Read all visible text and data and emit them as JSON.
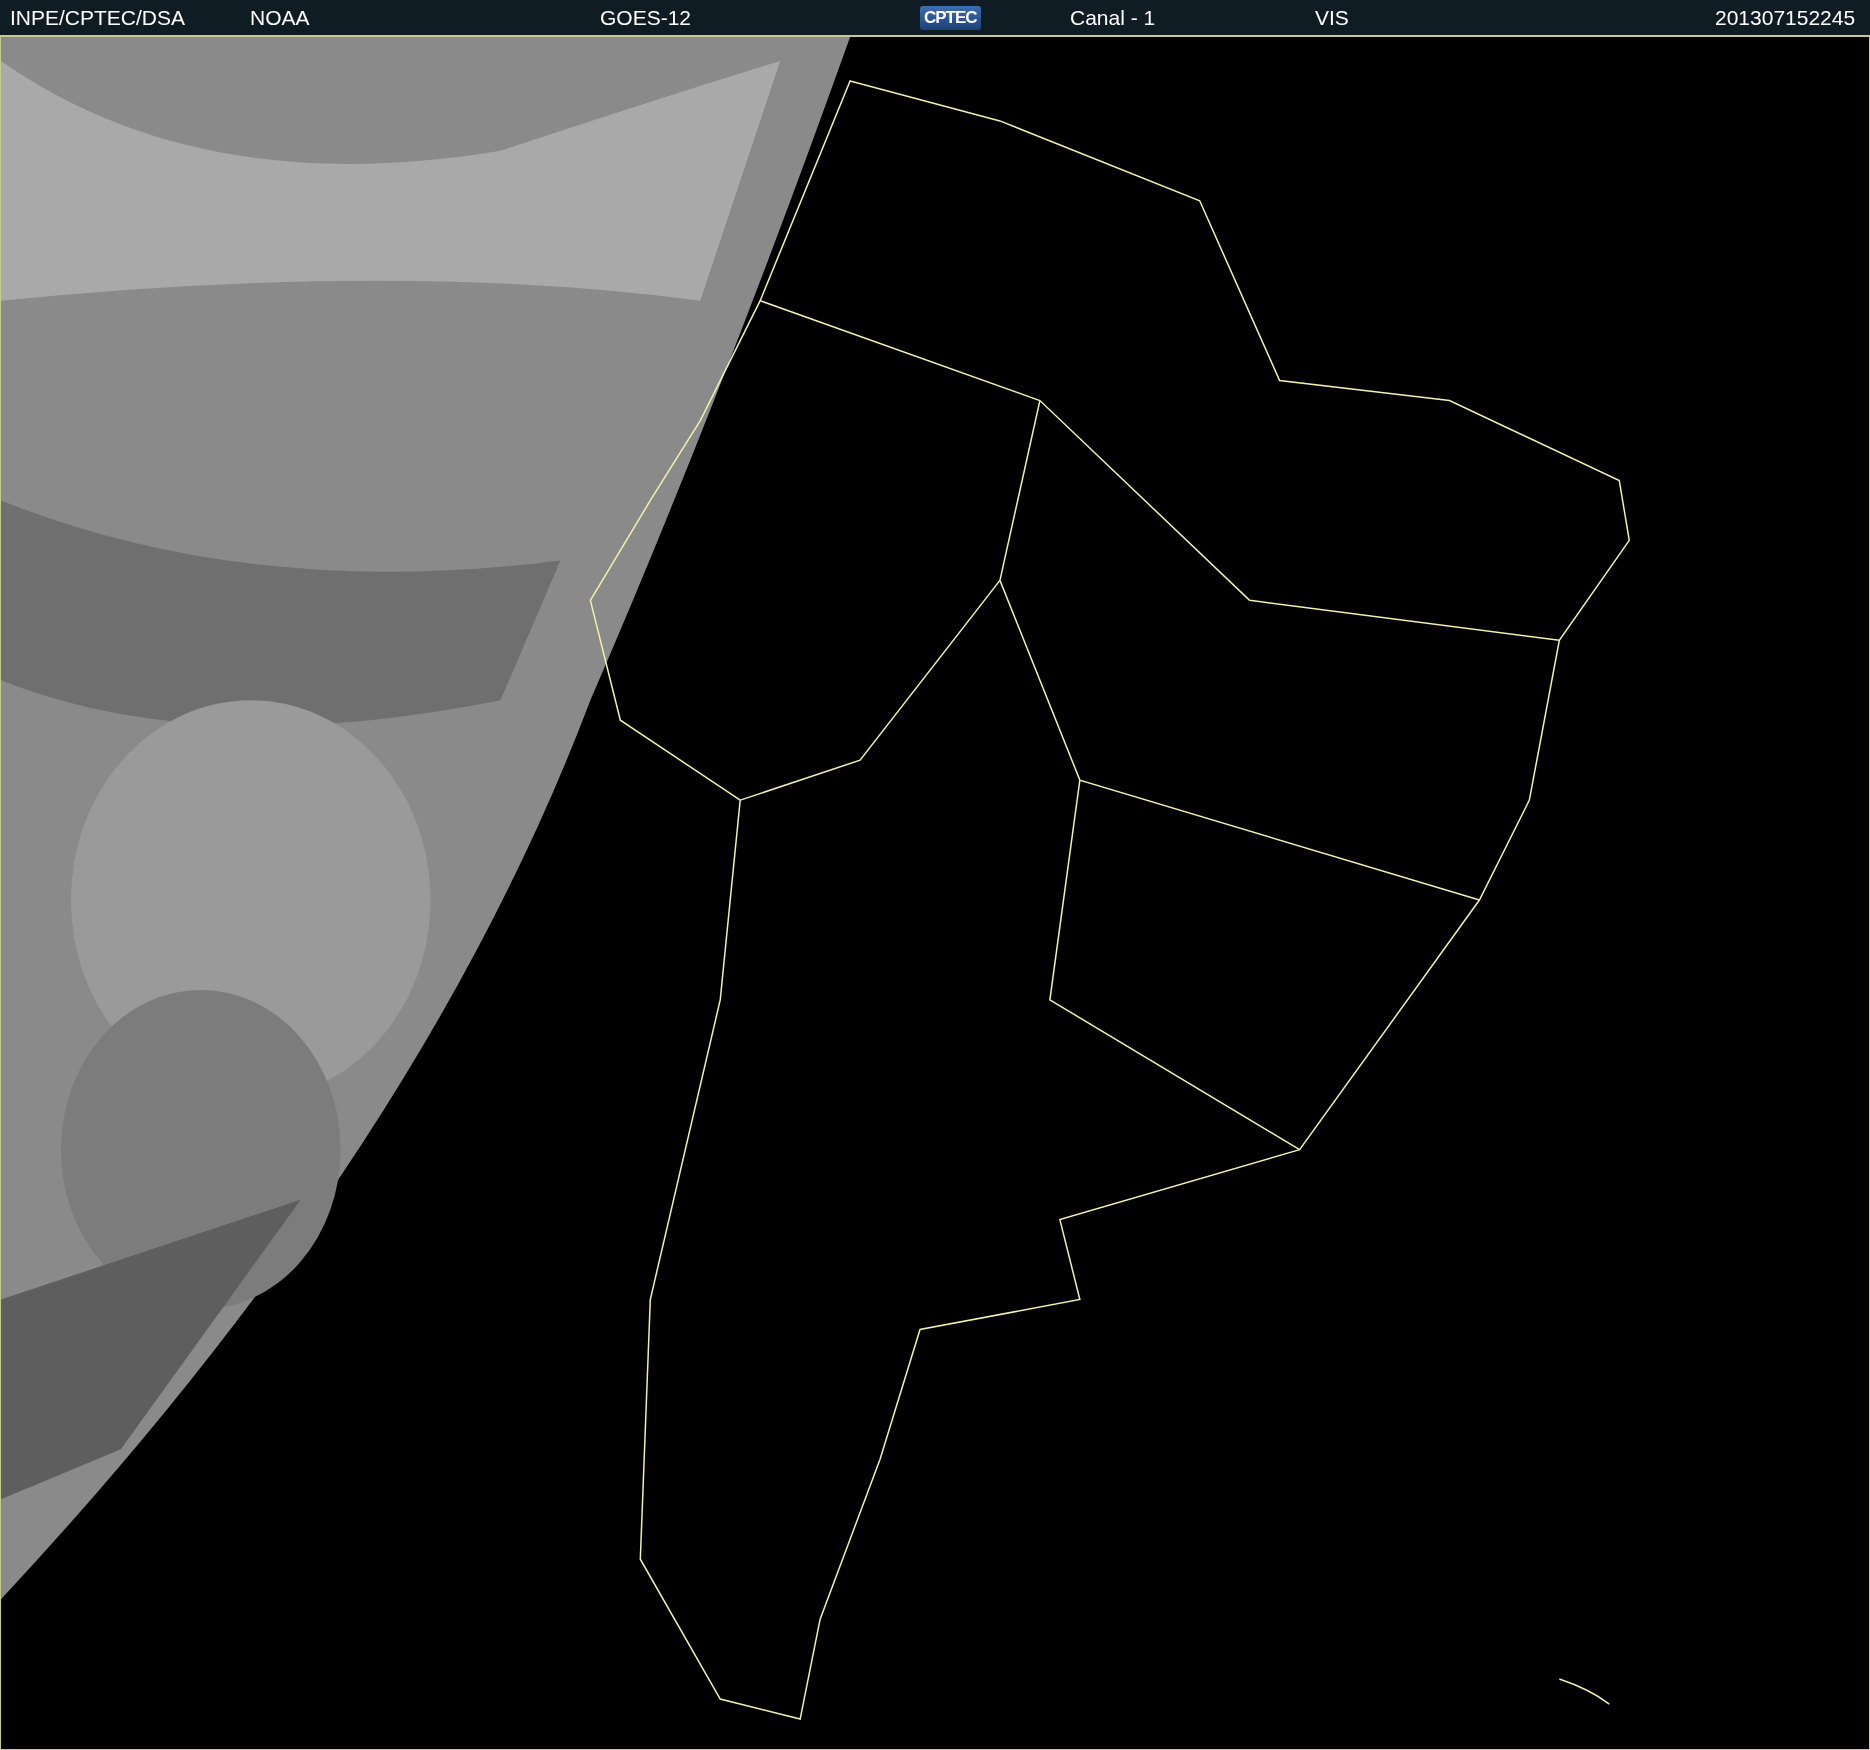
{
  "header": {
    "items": [
      {
        "kind": "text",
        "text": "INPE/CPTEC/DSA"
      },
      {
        "kind": "text",
        "text": "NOAA"
      },
      {
        "kind": "text",
        "text": "GOES-12"
      },
      {
        "kind": "logo",
        "text": "CPTEC"
      },
      {
        "kind": "text",
        "text": "Canal - 1"
      },
      {
        "kind": "text",
        "text": "VIS"
      },
      {
        "kind": "text",
        "text": "201307152245"
      }
    ]
  }
}
